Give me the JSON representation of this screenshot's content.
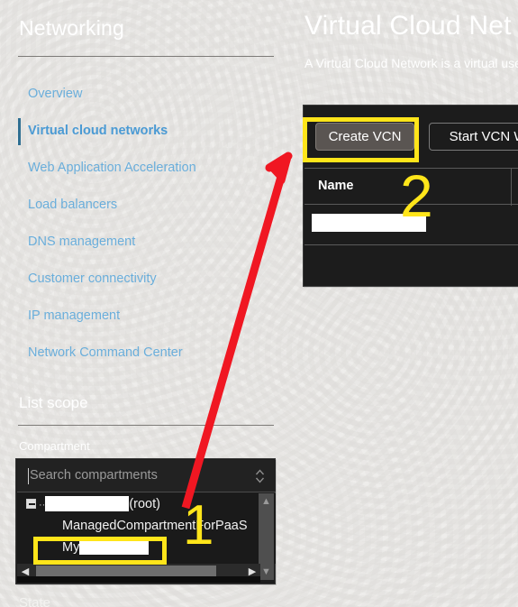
{
  "sidebar": {
    "title": "Networking",
    "nav_items": [
      {
        "label": "Overview",
        "active": false
      },
      {
        "label": "Virtual cloud networks",
        "active": true
      },
      {
        "label": "Web Application Acceleration",
        "active": false
      },
      {
        "label": "Load balancers",
        "active": false
      },
      {
        "label": "DNS management",
        "active": false
      },
      {
        "label": "Customer connectivity",
        "active": false
      },
      {
        "label": "IP management",
        "active": false
      },
      {
        "label": "Network Command Center",
        "active": false
      }
    ],
    "list_scope_title": "List scope",
    "compartment_label": "Compartment",
    "search_placeholder": "Search compartments",
    "tree": {
      "root_suffix": "(root)",
      "managed_item": "ManagedCompartmentForPaaS",
      "my_item_prefix": "My"
    },
    "state_label": "State",
    "icons": {
      "expand": "expand-minus-icon",
      "spinner": "stepper-updown-icon",
      "scroll_left": "◀",
      "scroll_right": "▶",
      "scroll_up": "▲",
      "scroll_down": "▼"
    }
  },
  "main": {
    "page_title": "Virtual Cloud Net",
    "page_subtitle": "A Virtual Cloud Network is a virtual use.",
    "toolbar": {
      "create_vcn_label": "Create VCN",
      "start_wizard_label": "Start VCN Wiz"
    },
    "table": {
      "columns": [
        "Name"
      ],
      "rows": [
        {
          "name": ""
        }
      ]
    }
  },
  "annotations": {
    "steps": [
      {
        "number": "1",
        "target": "compartment-my-row"
      },
      {
        "number": "2",
        "target": "vcn-table-name"
      }
    ],
    "arrow": {
      "from": "compartment-my-row",
      "to": "create-vcn-button"
    },
    "colors": {
      "highlight": "#ffe51a",
      "arrow": "#f01722",
      "link": "#6aaedb",
      "link_active": "#4a9ad4",
      "page_background": "#eeedeb",
      "panel_background": "#1c1c1c",
      "button_face": "#5a5552"
    }
  }
}
